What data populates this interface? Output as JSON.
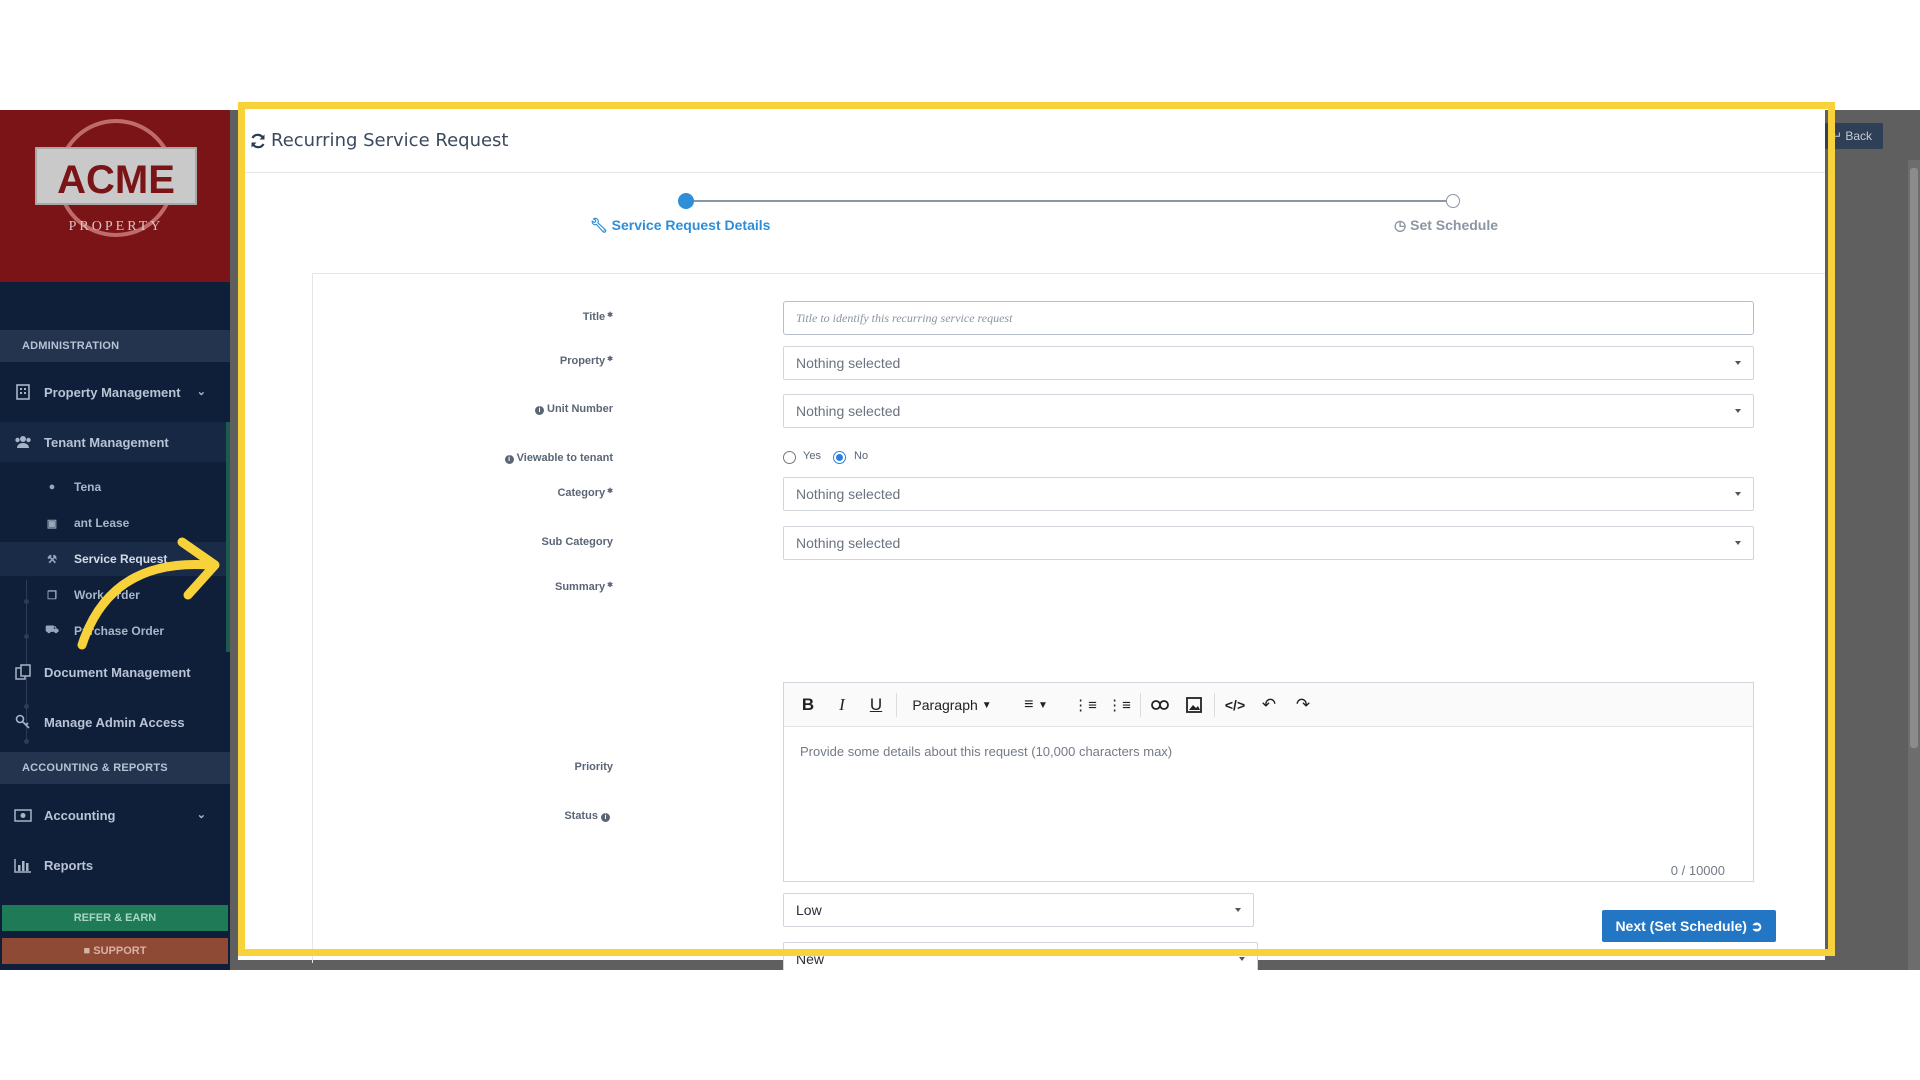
{
  "brand": {
    "name": "ACME",
    "tagline": "PROPERTY",
    "colors": {
      "logo_bg": "#7a1416",
      "sidebar_bg": "#0f1f3a",
      "accent": "#2e8fd8",
      "highlight": "#f8d23a"
    }
  },
  "sidebar": {
    "sections": {
      "administration": "ADMINISTRATION",
      "accounting": "ACCOUNTING & REPORTS"
    },
    "items": [
      {
        "label": "Property Management",
        "icon": "building-icon"
      },
      {
        "label": "Tenant Management",
        "icon": "users-icon"
      },
      {
        "label": "Document Management",
        "icon": "documents-icon"
      },
      {
        "label": "Manage Admin Access",
        "icon": "key-icon"
      },
      {
        "label": "Accounting",
        "icon": "money-icon"
      },
      {
        "label": "Reports",
        "icon": "bar-chart-icon"
      }
    ],
    "sub_items": [
      {
        "label": "Tena",
        "icon": "user-icon"
      },
      {
        "label": "ant Lease",
        "icon": "calendar-icon"
      },
      {
        "label": "Service Request",
        "icon": "wrench-icon"
      },
      {
        "label": "Work Order",
        "icon": "copy-icon"
      },
      {
        "label": "Purchase Order",
        "icon": "truck-icon"
      }
    ],
    "refer": "REFER & EARN",
    "support": "SUPPORT"
  },
  "back_button": "Back",
  "modal": {
    "title": "Recurring Service Request",
    "steps": [
      {
        "label": "Service Request Details",
        "state": "active"
      },
      {
        "label": "Set Schedule",
        "state": "pending"
      }
    ],
    "form": {
      "title_label": "Title",
      "title_placeholder": "Title to identify this recurring service request",
      "property_label": "Property",
      "property_value": "Nothing selected",
      "unit_label": "Unit Number",
      "unit_value": "Nothing selected",
      "viewable_label": "Viewable to tenant",
      "viewable_yes": "Yes",
      "viewable_no": "No",
      "viewable_selected": "No",
      "category_label": "Category",
      "category_value": "Nothing selected",
      "subcategory_label": "Sub Category",
      "subcategory_value": "Nothing selected",
      "summary_label": "Summary",
      "editor_format": "Paragraph",
      "summary_placeholder": "Provide some details about this request (10,000 characters max)",
      "char_count": "0 / 10000",
      "priority_label": "Priority",
      "priority_value": "Low",
      "status_label": "Status",
      "status_value": "New"
    },
    "next_button": "Next (Set Schedule)"
  }
}
